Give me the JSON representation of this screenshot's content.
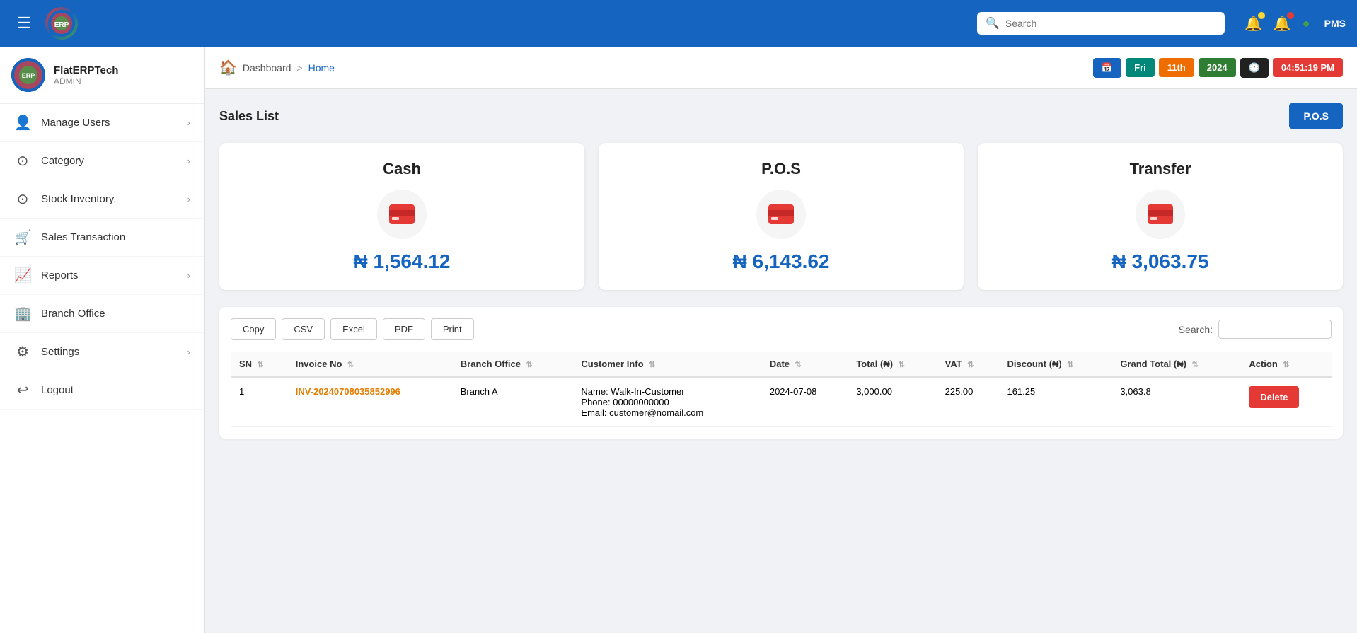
{
  "topbar": {
    "menu_icon": "☰",
    "logo_text": "ERP",
    "search_placeholder": "Search",
    "pms_label": "PMS",
    "bell_icon": "🔔",
    "alert_icon": "🔔"
  },
  "sidebar": {
    "company_name": "FlatERPTech",
    "role": "ADMIN",
    "nav_items": [
      {
        "id": "manage-users",
        "label": "Manage Users",
        "icon": "👤",
        "has_arrow": true
      },
      {
        "id": "category",
        "label": "Category",
        "icon": "⊙",
        "has_arrow": true
      },
      {
        "id": "stock-inventory",
        "label": "Stock Inventory.",
        "icon": "⊙",
        "has_arrow": true
      },
      {
        "id": "sales-transaction",
        "label": "Sales Transaction",
        "icon": "🛒",
        "has_arrow": false
      },
      {
        "id": "reports",
        "label": "Reports",
        "icon": "📈",
        "has_arrow": true
      },
      {
        "id": "branch-office",
        "label": "Branch Office",
        "icon": "🏢",
        "has_arrow": false
      },
      {
        "id": "settings",
        "label": "Settings",
        "icon": "⚙",
        "has_arrow": true
      },
      {
        "id": "logout",
        "label": "Logout",
        "icon": "↩",
        "has_arrow": false
      }
    ]
  },
  "breadcrumb": {
    "dashboard": "Dashboard",
    "separator": ">",
    "current": "Home",
    "home_icon": "🏠"
  },
  "date_badges": [
    {
      "id": "cal",
      "label": "📅",
      "color": "badge-blue"
    },
    {
      "id": "day",
      "label": "Fri",
      "color": "badge-teal"
    },
    {
      "id": "date",
      "label": "11th",
      "color": "badge-orange"
    },
    {
      "id": "year",
      "label": "2024",
      "color": "badge-green2"
    },
    {
      "id": "clock",
      "label": "🕐",
      "color": "badge-dark"
    },
    {
      "id": "time",
      "label": "04:51:19 PM",
      "color": "badge-red2"
    }
  ],
  "sales": {
    "title": "Sales List",
    "pos_button": "P.O.S",
    "cards": [
      {
        "id": "cash",
        "title": "Cash",
        "amount": "₦ 1,564.12"
      },
      {
        "id": "pos",
        "title": "P.O.S",
        "amount": "₦ 6,143.62"
      },
      {
        "id": "transfer",
        "title": "Transfer",
        "amount": "₦ 3,063.75"
      }
    ],
    "table_buttons": [
      {
        "id": "copy",
        "label": "Copy"
      },
      {
        "id": "csv",
        "label": "CSV"
      },
      {
        "id": "excel",
        "label": "Excel"
      },
      {
        "id": "pdf",
        "label": "PDF"
      },
      {
        "id": "print",
        "label": "Print"
      }
    ],
    "search_label": "Search:",
    "table_headers": [
      {
        "id": "sn",
        "label": "SN"
      },
      {
        "id": "invoice-no",
        "label": "Invoice No"
      },
      {
        "id": "branch-office",
        "label": "Branch Office"
      },
      {
        "id": "customer-info",
        "label": "Customer Info"
      },
      {
        "id": "date",
        "label": "Date"
      },
      {
        "id": "total",
        "label": "Total (₦)"
      },
      {
        "id": "vat",
        "label": "VAT"
      },
      {
        "id": "discount",
        "label": "Discount (₦)"
      },
      {
        "id": "grand-total",
        "label": "Grand Total (₦)"
      },
      {
        "id": "action",
        "label": "Action"
      }
    ],
    "table_rows": [
      {
        "sn": "1",
        "invoice_no": "INV-20240708035852996",
        "branch_office": "Branch A",
        "customer_name": "Name: Walk-In-Customer",
        "customer_phone": "Phone: 00000000000",
        "customer_email": "Email: customer@nomail.com",
        "date": "2024-07-08",
        "total": "3,000.00",
        "vat": "225.00",
        "discount": "161.25",
        "grand_total": "3,063.8",
        "action_label": "Delete"
      }
    ]
  }
}
